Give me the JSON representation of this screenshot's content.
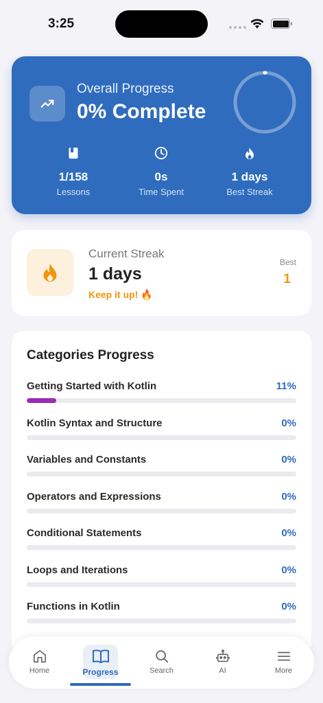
{
  "status_bar": {
    "time": "3:25"
  },
  "overall": {
    "label": "Overall Progress",
    "value": "0% Complete",
    "progress_fraction": 0.0,
    "stats": [
      {
        "icon": "book-icon",
        "value": "1/158",
        "label": "Lessons"
      },
      {
        "icon": "clock-icon",
        "value": "0s",
        "label": "Time Spent"
      },
      {
        "icon": "flame-icon",
        "value": "1 days",
        "label": "Best Streak"
      }
    ]
  },
  "streak": {
    "label": "Current Streak",
    "value": "1 days",
    "message": "Keep it up! 🔥",
    "best_label": "Best",
    "best_value": "1"
  },
  "categories": {
    "title": "Categories Progress",
    "items": [
      {
        "name": "Getting Started with Kotlin",
        "percent": "11%",
        "fraction": 0.11
      },
      {
        "name": "Kotlin Syntax and Structure",
        "percent": "0%",
        "fraction": 0
      },
      {
        "name": "Variables and Constants",
        "percent": "0%",
        "fraction": 0
      },
      {
        "name": "Operators and Expressions",
        "percent": "0%",
        "fraction": 0
      },
      {
        "name": "Conditional Statements",
        "percent": "0%",
        "fraction": 0
      },
      {
        "name": "Loops and Iterations",
        "percent": "0%",
        "fraction": 0
      },
      {
        "name": "Functions in Kotlin",
        "percent": "0%",
        "fraction": 0
      }
    ]
  },
  "nav": {
    "items": [
      {
        "icon": "home-icon",
        "label": "Home"
      },
      {
        "icon": "book-open-icon",
        "label": "Progress",
        "active": true
      },
      {
        "icon": "search-icon",
        "label": "Search"
      },
      {
        "icon": "robot-icon",
        "label": "AI"
      },
      {
        "icon": "menu-icon",
        "label": "More"
      }
    ]
  },
  "colors": {
    "primary": "#2f6cbd",
    "accent_orange": "#f0960e",
    "category_bar": "#9a2db5"
  }
}
